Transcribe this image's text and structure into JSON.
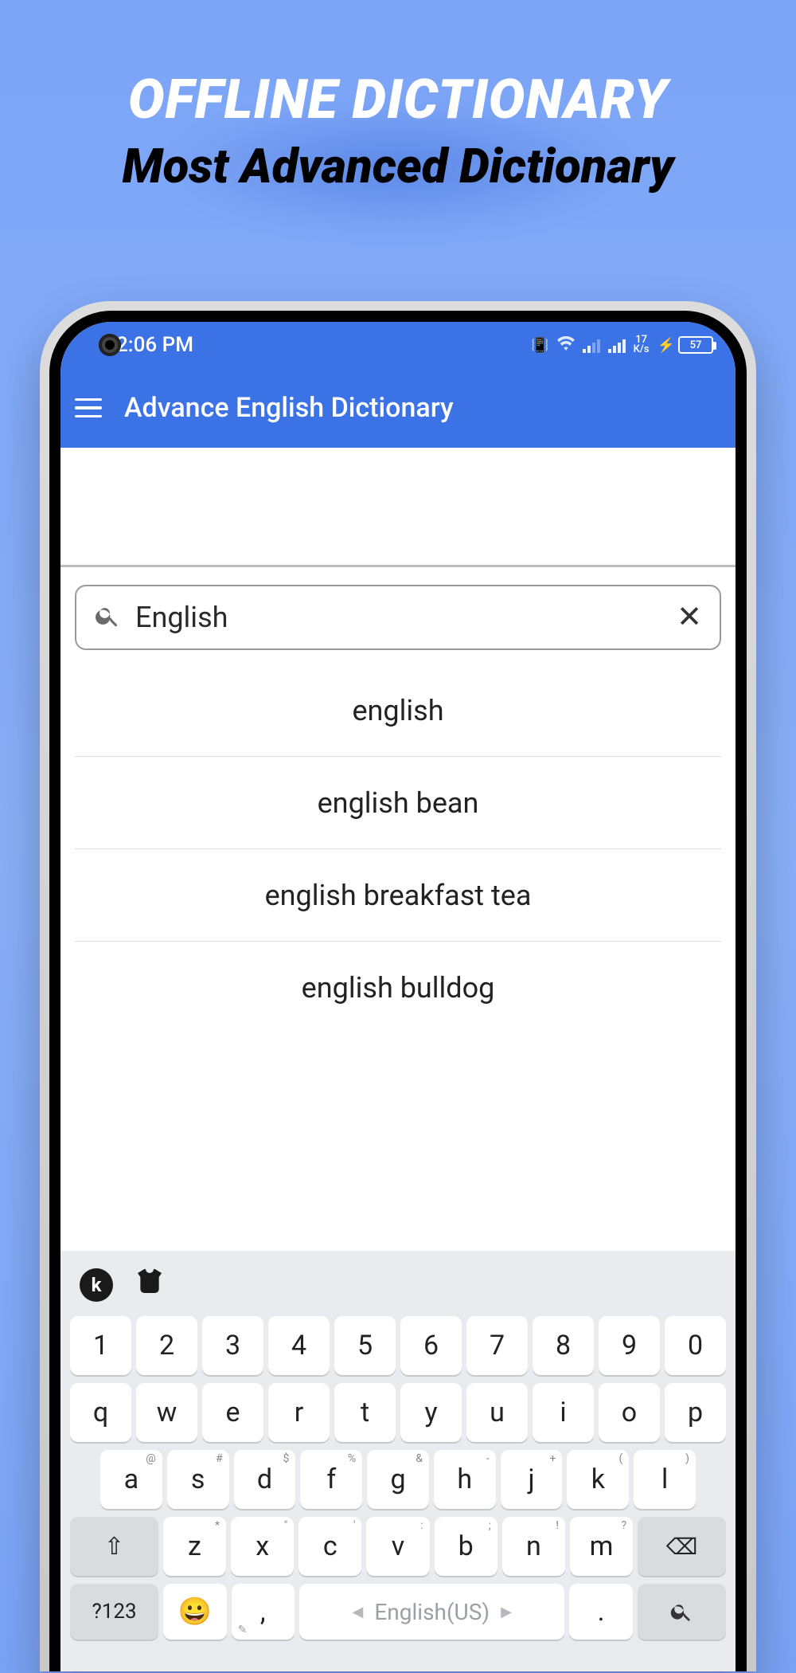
{
  "promo": {
    "line1": "OFFLINE DICTIONARY",
    "line2": "Most Advanced Dictionary"
  },
  "status": {
    "time": "2:06 PM",
    "speed_top": "17",
    "speed_bottom": "K/s",
    "battery": "57",
    "bolt": "⚡"
  },
  "appbar": {
    "title": "Advance English Dictionary"
  },
  "search": {
    "value": "English"
  },
  "suggestions": [
    "english",
    "english bean",
    "english breakfast tea",
    "english bulldog"
  ],
  "keyboard": {
    "row_num": [
      "1",
      "2",
      "3",
      "4",
      "5",
      "6",
      "7",
      "8",
      "9",
      "0"
    ],
    "row1": [
      "q",
      "w",
      "e",
      "r",
      "t",
      "y",
      "u",
      "i",
      "o",
      "p"
    ],
    "row2": {
      "keys": [
        "a",
        "s",
        "d",
        "f",
        "g",
        "h",
        "j",
        "k",
        "l"
      ],
      "hints": [
        "@",
        "#",
        "$",
        "%",
        "&",
        "-",
        "+",
        "(",
        ")"
      ]
    },
    "row3": {
      "keys": [
        "z",
        "x",
        "c",
        "v",
        "b",
        "n",
        "m"
      ],
      "hints": [
        "*",
        "\"",
        "'",
        ":",
        ";",
        "!",
        "?"
      ]
    },
    "sym_label": "?123",
    "space_label": "English(US)",
    "comma": ",",
    "period": "."
  }
}
